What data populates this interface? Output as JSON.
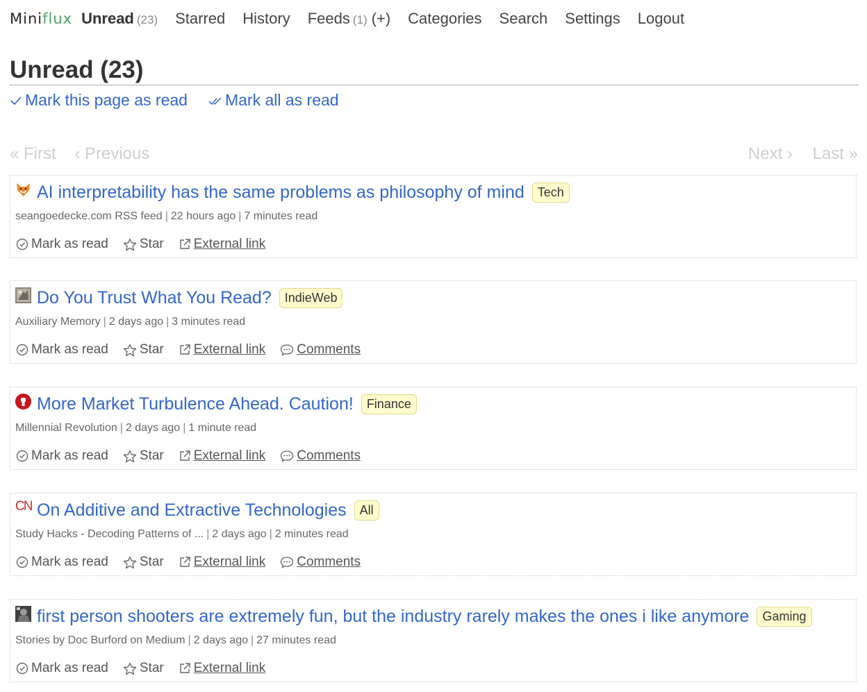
{
  "header": {
    "logo_part1": "Mini",
    "logo_part2": "flux",
    "nav": {
      "unread": "Unread",
      "unread_count": "(23)",
      "starred": "Starred",
      "history": "History",
      "feeds": "Feeds",
      "feeds_count": "(1)",
      "feeds_add": "(+)",
      "categories": "Categories",
      "search": "Search",
      "settings": "Settings",
      "logout": "Logout"
    }
  },
  "page": {
    "title": "Unread (23)",
    "mark_page_read": "Mark this page as read",
    "mark_all_read": "Mark all as read"
  },
  "pagination": {
    "first": "« First",
    "previous": "‹ Previous",
    "next": "Next ›",
    "last": "Last »"
  },
  "colors": {
    "link": "#3366cc",
    "logo_flux": "#4aa366",
    "category_bg": "#fffbcc",
    "disabled": "#cfcfcf"
  },
  "actions": {
    "mark_read": "Mark as read",
    "star": "Star",
    "external": "External link",
    "comments": "Comments"
  },
  "entries": [
    {
      "favicon": "fox-icon",
      "title": "AI interpretability has the same problems as philosophy of mind",
      "category": "Tech",
      "feed": "seangoedecke.com RSS feed",
      "date": "22 hours ago",
      "reading_time": "7 minutes read"
    },
    {
      "favicon": "photo-icon",
      "title": "Do You Trust What You Read?",
      "category": "IndieWeb",
      "feed": "Auxiliary Memory",
      "date": "2 days ago",
      "reading_time": "3 minutes read"
    },
    {
      "favicon": "red-fist-icon",
      "title": "More Market Turbulence Ahead. Caution!",
      "category": "Finance",
      "feed": "Millennial Revolution",
      "date": "2 days ago",
      "reading_time": "1 minute read"
    },
    {
      "favicon": "cn-logo-icon",
      "favicon_text": "CN",
      "title": "On Additive and Extractive Technologies",
      "category": "All",
      "feed": "Study Hacks - Decoding Patterns of ...",
      "date": "2 days ago",
      "reading_time": "2 minutes read"
    },
    {
      "favicon": "photo-icon",
      "title": "first person shooters are extremely fun, but the industry rarely makes the ones i like anymore",
      "category": "Gaming",
      "feed": "Stories by Doc Burford on Medium",
      "date": "2 days ago",
      "reading_time": "27 minutes read"
    }
  ]
}
